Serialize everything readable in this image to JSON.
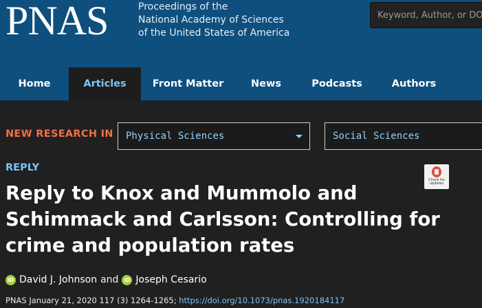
{
  "header": {
    "logo": "PNAS",
    "tagline": [
      "Proceedings of the",
      "National Academy of Sciences",
      "of the United States of America"
    ],
    "search_placeholder": "Keyword, Author, or DOI"
  },
  "nav": {
    "items": [
      {
        "label": "Home",
        "active": false
      },
      {
        "label": "Articles",
        "active": true
      },
      {
        "label": "Front Matter",
        "active": false
      },
      {
        "label": "News",
        "active": false
      },
      {
        "label": "Podcasts",
        "active": false
      },
      {
        "label": "Authors",
        "active": false
      }
    ]
  },
  "new_research": {
    "label": "NEW RESEARCH IN",
    "selects": [
      "Physical Sciences",
      "Social Sciences"
    ]
  },
  "article": {
    "type": "REPLY",
    "title": "Reply to Knox and Mummolo and Schimmack and Carlsson: Controlling for crime and population rates",
    "badge_text": "Check for updates",
    "authors": [
      "David J. Johnson",
      "Joseph Cesario"
    ],
    "author_sep": "and",
    "orcid_glyph": "iD",
    "citation": "PNAS January 21, 2020 117 (3) 1264-1265; ",
    "doi": "https://doi.org/10.1073/pnas.1920184117"
  },
  "colors": {
    "header_bg": "#0e4f7e",
    "page_bg": "#202020",
    "accent_orange": "#ef6f4a",
    "link_blue": "#7dc4f7",
    "orcid_green": "#a6ce39"
  }
}
